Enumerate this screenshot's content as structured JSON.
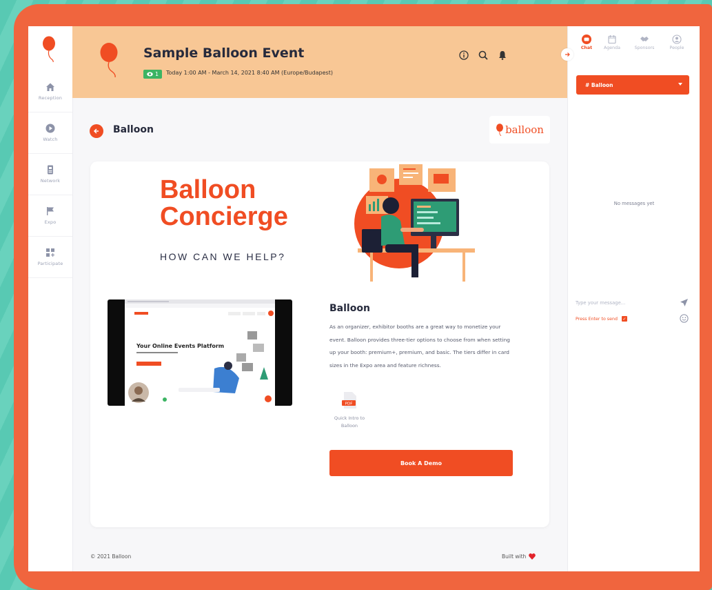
{
  "colors": {
    "accent": "#f04d23",
    "header_bg": "#f8c795",
    "frame": "#f0653e",
    "badge_green": "#3cb463"
  },
  "nav": {
    "items": [
      {
        "label": "Reception",
        "icon": "home-icon"
      },
      {
        "label": "Watch",
        "icon": "play-icon"
      },
      {
        "label": "Network",
        "icon": "badge-icon"
      },
      {
        "label": "Expo",
        "icon": "flag-icon"
      },
      {
        "label": "Participate",
        "icon": "grid-plus-icon"
      }
    ]
  },
  "header": {
    "title": "Sample Balloon Event",
    "viewers": "1",
    "date": "Today 1:00 AM - March 14, 2021 8:40 AM (Europe/Budapest)",
    "icons": [
      "info-icon",
      "search-icon",
      "bell-icon"
    ]
  },
  "booth": {
    "title": "Balloon",
    "logo_text": "balloon",
    "banner": {
      "title_line1": "Balloon",
      "title_line2": "Concierge",
      "subtitle": "HOW CAN WE HELP?"
    },
    "video": {
      "headline": "Your Online Events Platform"
    },
    "exhibitor": {
      "name": "Balloon",
      "description": "As an organizer, exhibitor booths are a great way to monetize your event. Balloon provides three-tier options to choose from when setting up your booth: premium+, premium, and basic. The tiers differ in card sizes in the Expo area and feature richness."
    },
    "file": {
      "badge": "PDF",
      "caption_line1": "Quick Intro to",
      "caption_line2": "Balloon"
    },
    "cta": "Book A Demo"
  },
  "footer": {
    "copyright": "© 2021 Balloon",
    "built_with": "Built with"
  },
  "chat": {
    "tabs": [
      {
        "label": "Chat",
        "icon": "chat-icon"
      },
      {
        "label": "Agenda",
        "icon": "calendar-icon"
      },
      {
        "label": "Sponsors",
        "icon": "handshake-icon"
      },
      {
        "label": "People",
        "icon": "person-icon"
      }
    ],
    "channel": "# Balloon",
    "empty": "No messages yet",
    "placeholder": "Type your message...",
    "press_enter": "Press Enter to send"
  }
}
